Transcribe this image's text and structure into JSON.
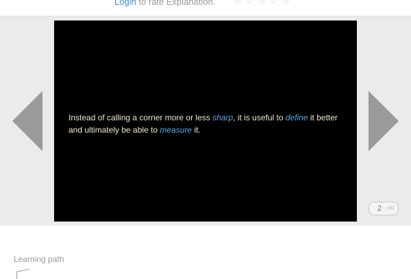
{
  "rating": {
    "login_label": "Login",
    "prompt_text": " to rate Explanation.",
    "stars": "☆☆☆☆☆",
    "star_count": 5
  },
  "slide": {
    "segments": [
      {
        "text": "Instead of calling a corner more or less ",
        "emphasis": false
      },
      {
        "text": "sharp",
        "emphasis": true
      },
      {
        "text": ", it is useful to ",
        "emphasis": false
      },
      {
        "text": "define",
        "emphasis": true
      },
      {
        "text": " it better and ultimately be able to ",
        "emphasis": false
      },
      {
        "text": "measure",
        "emphasis": true
      },
      {
        "text": " it.",
        "emphasis": false
      }
    ]
  },
  "navigation": {
    "prev_icon": "triangle-left-icon",
    "next_icon": "triangle-right-icon"
  },
  "pager": {
    "current": "2",
    "total": "of11"
  },
  "learning_path": {
    "label": "Learning path",
    "icon": "path-icon"
  },
  "colors": {
    "link": "#3a8fd0",
    "emphasis": "#5aa9ea",
    "slide_text": "#f2e8c8",
    "arrow": "#9a9a9a",
    "stage_bg": "#ebebeb"
  }
}
